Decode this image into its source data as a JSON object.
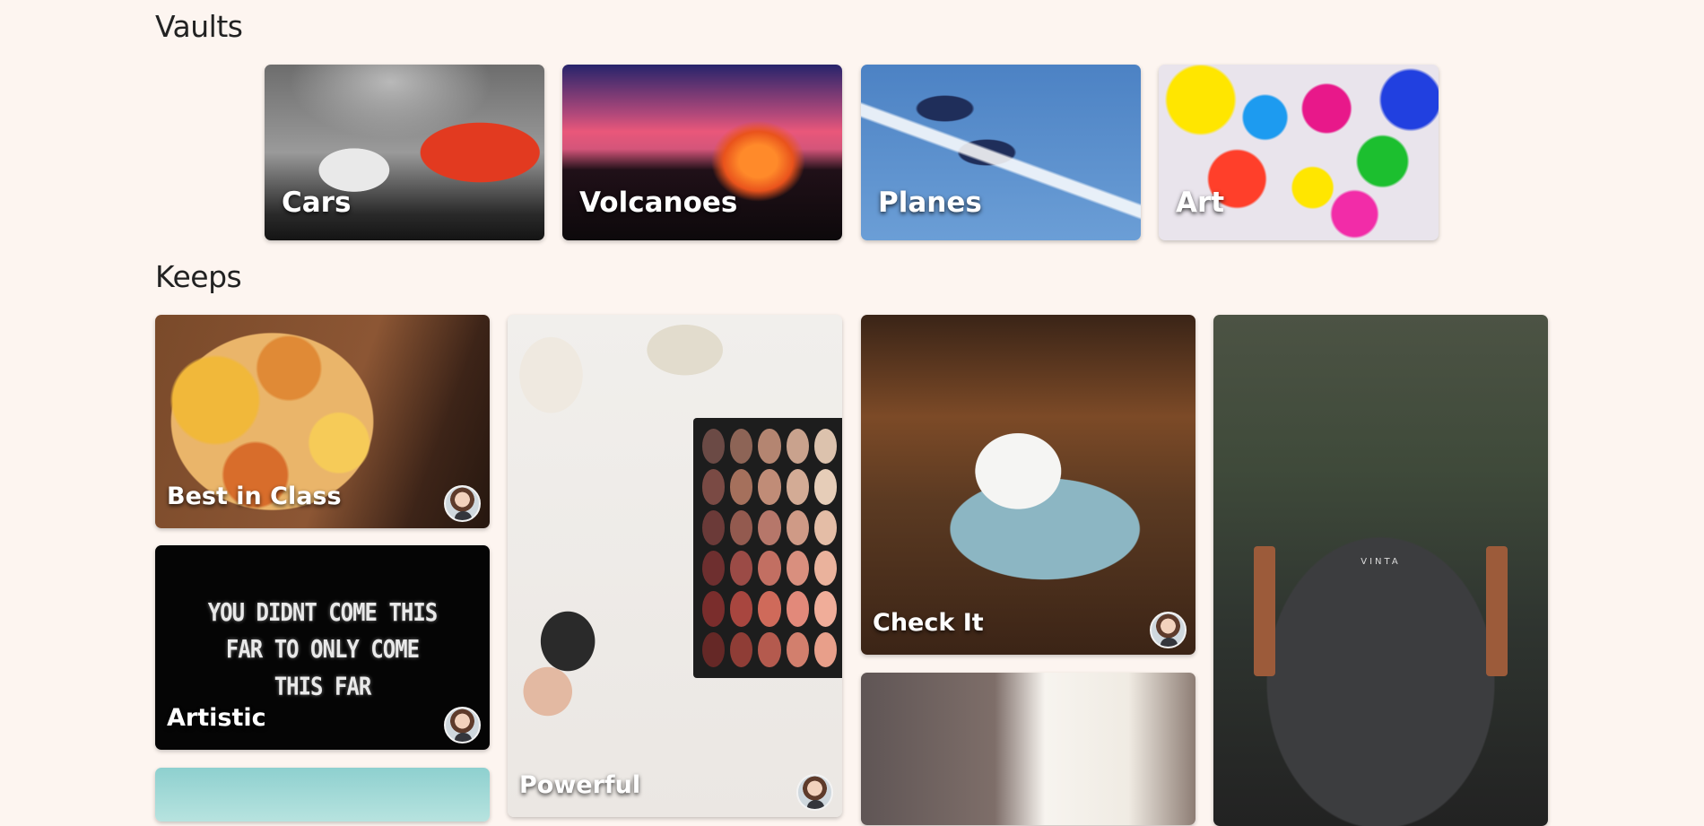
{
  "sections": {
    "vaults_title": "Vaults",
    "keeps_title": "Keeps"
  },
  "vaults": [
    {
      "name": "Cars"
    },
    {
      "name": "Volcanoes"
    },
    {
      "name": "Planes"
    },
    {
      "name": "Art"
    }
  ],
  "keeps": {
    "best_in_class": "Best in Class",
    "artistic": "Artistic",
    "artistic_image_text": [
      "YOU DIDNT COME THIS",
      "FAR TO ONLY COME",
      "THIS FAR"
    ],
    "powerful": "Powerful",
    "check_it": "Check It",
    "backpack_brand": "VINTA"
  },
  "colors": {
    "background": "#fdf5f0",
    "heading": "#222222",
    "card_label": "#ffffff"
  },
  "palette_colors": [
    "#6b4a45",
    "#8d6456",
    "#b48571",
    "#c9a28d",
    "#dcc2ad",
    "#7a4a44",
    "#a5705c",
    "#c08c77",
    "#d3ab95",
    "#e6cdb8",
    "#6b3a38",
    "#935a4f",
    "#b6776a",
    "#cf9a86",
    "#e4bda6",
    "#6e2f2f",
    "#9b4b46",
    "#c26f62",
    "#d98f7e",
    "#eab29c",
    "#7a2d2c",
    "#a8463f",
    "#cf6a5a",
    "#e2897a",
    "#f0ad99",
    "#652826",
    "#8f3d36",
    "#b45a4e",
    "#d27f6d",
    "#e89f8a"
  ]
}
